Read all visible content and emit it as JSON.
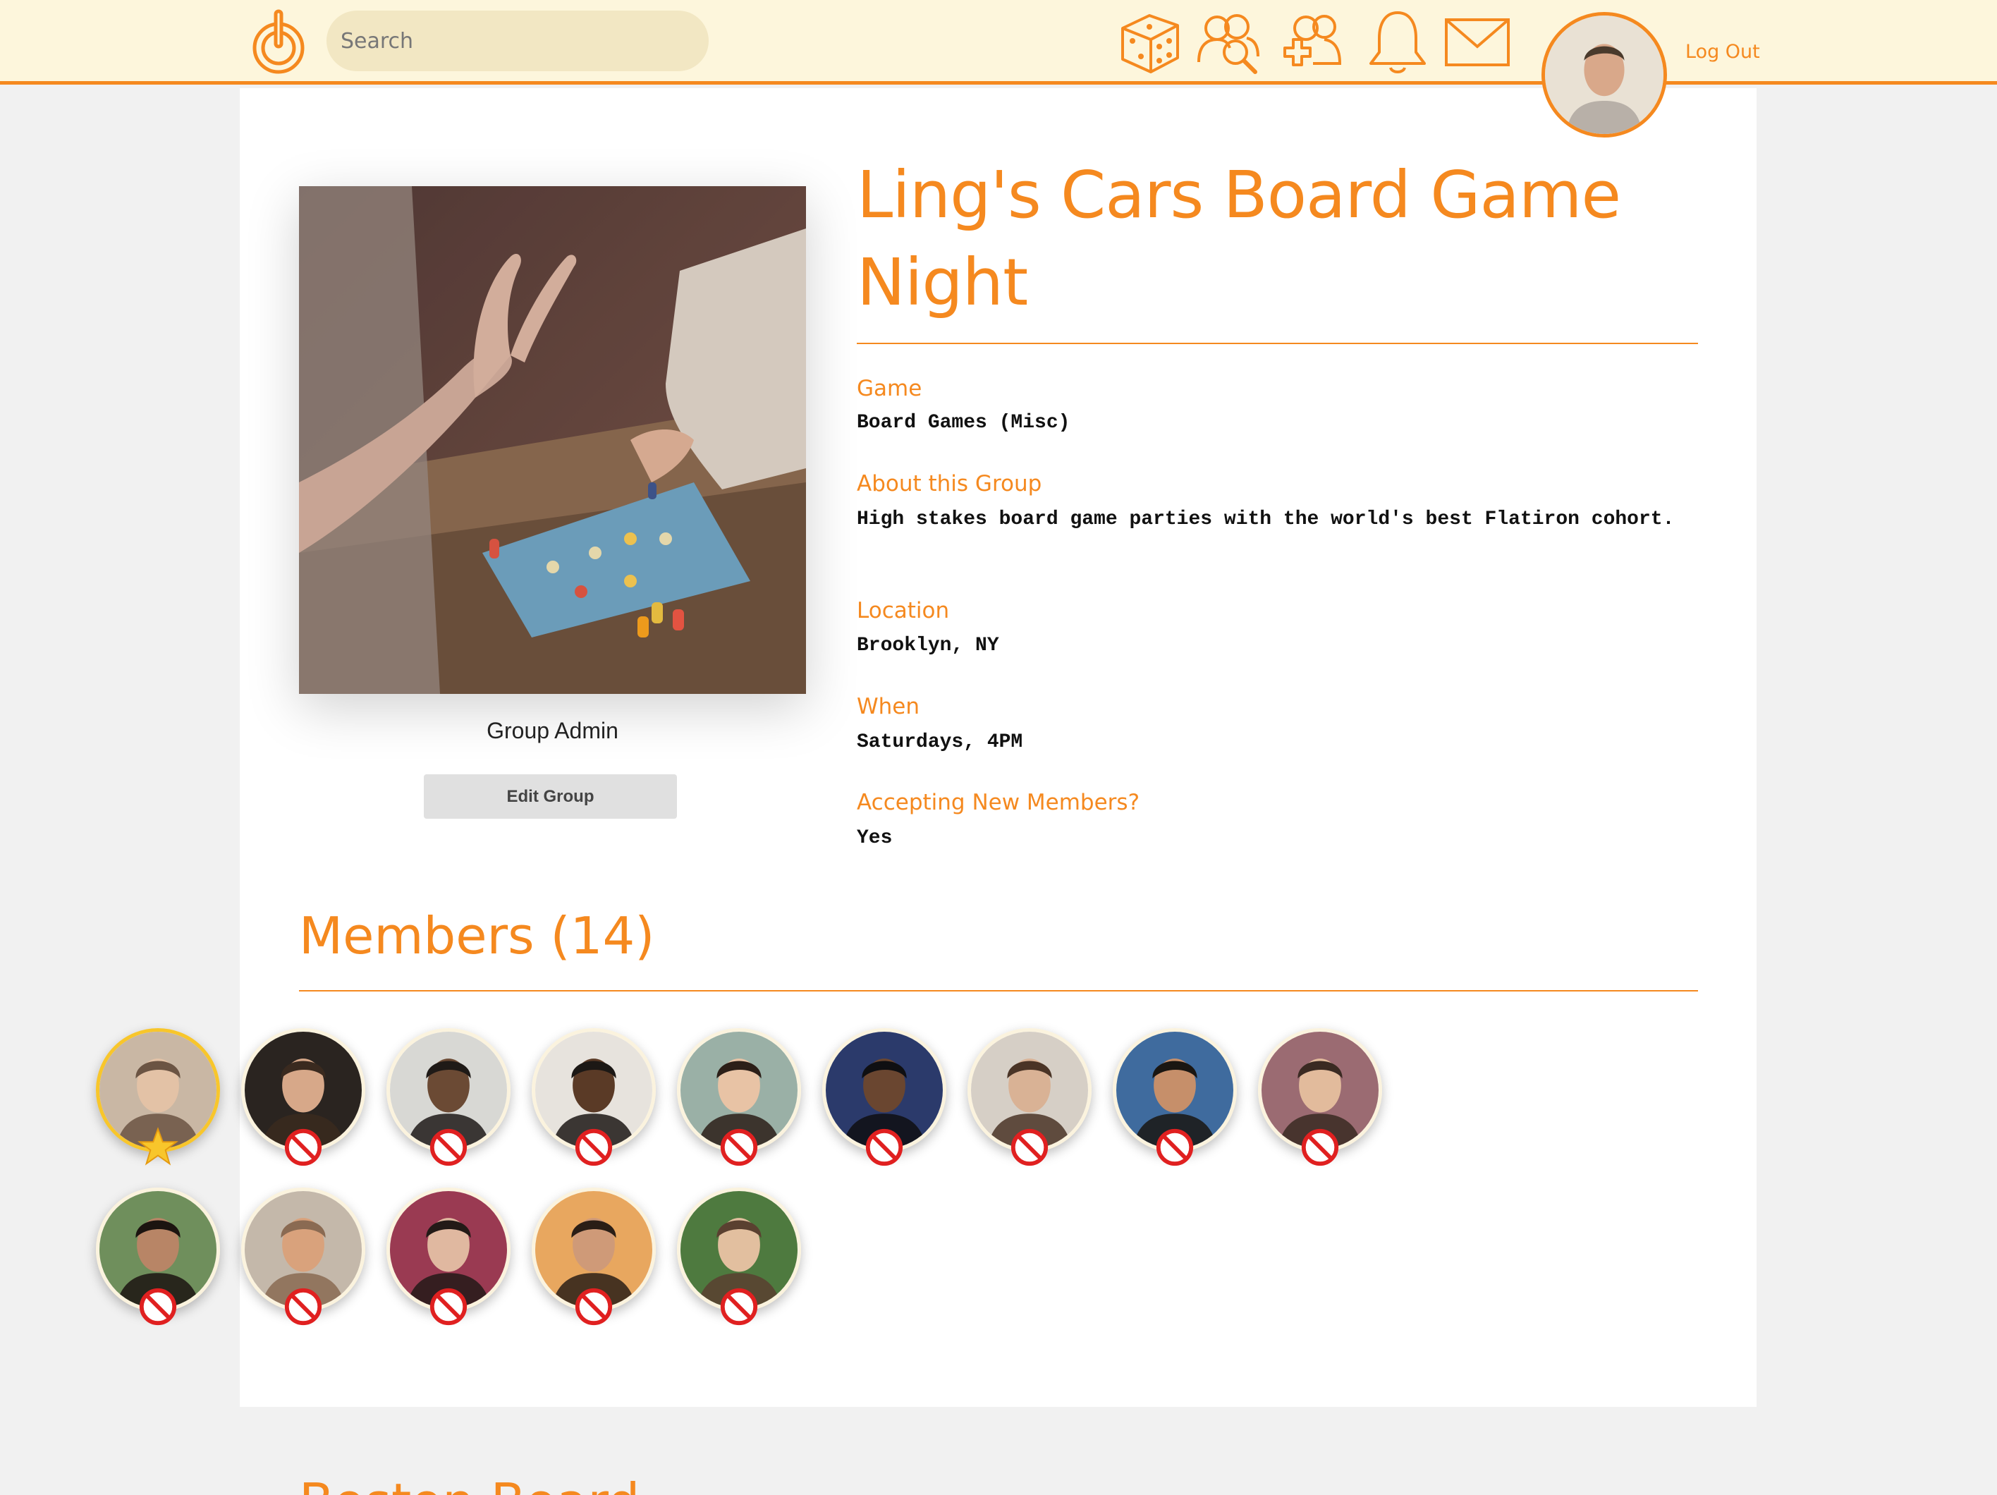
{
  "topbar": {
    "search_placeholder": "Search",
    "nav_icons": [
      "dice-icon",
      "groups-search-icon",
      "add-group-icon",
      "bell-icon",
      "mail-icon"
    ],
    "logout_label": "Log Out"
  },
  "group": {
    "title": "Ling's Cars Board Game Night",
    "admin_label": "Group Admin",
    "edit_label": "Edit Group",
    "fields": [
      {
        "label": "Game",
        "value": "Board Games (Misc)"
      },
      {
        "label": "About this Group",
        "value": "High stakes board game parties with the world's best Flatiron cohort."
      },
      {
        "label": "Location",
        "value": "Brooklyn, NY"
      },
      {
        "label": "When",
        "value": "Saturdays, 4PM"
      },
      {
        "label": "Accepting New Members?",
        "value": "Yes"
      }
    ]
  },
  "members": {
    "title": "Members (14)",
    "admin_badge_icon": "star-icon",
    "remove_badge_icon": "remove-member-icon"
  },
  "next_section": {
    "title": "Boston Board"
  },
  "colors": {
    "accent": "#f5891f",
    "topbar_bg": "#fdf6dc",
    "search_bg": "#f2e7c3",
    "admin_ring": "#f8c62b",
    "remove_red": "#e02020"
  }
}
